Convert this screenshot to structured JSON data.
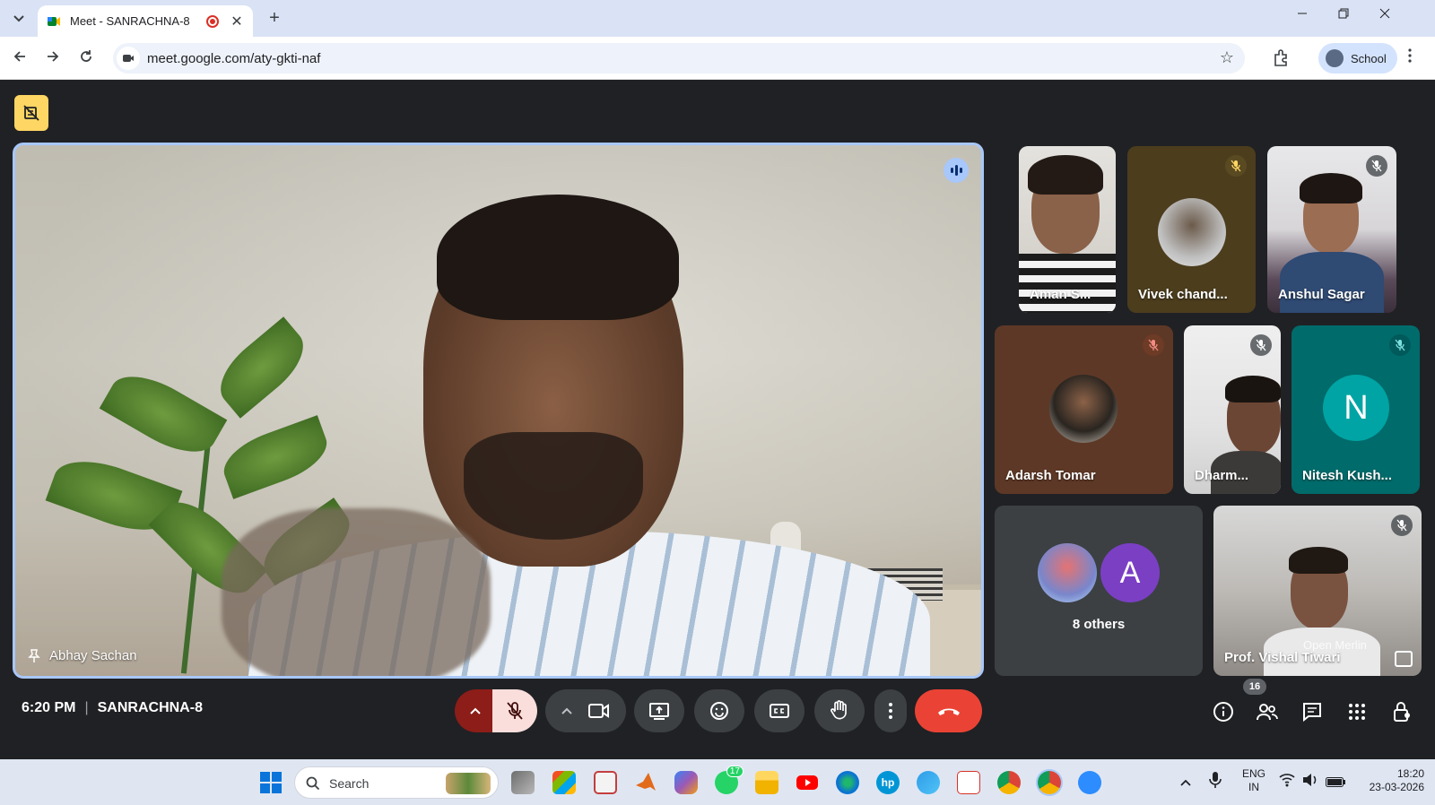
{
  "browser": {
    "tab_title": "Meet - SANRACHNA-8",
    "tab_close": "✕",
    "new_tab": "+",
    "url": "meet.google.com/aty-gkti-naf",
    "profile_label": "School"
  },
  "meet": {
    "main_speaker": "Abhay Sachan",
    "participants": [
      {
        "name": "Aman S...",
        "muted": false
      },
      {
        "name": "Vivek chand...",
        "muted": true
      },
      {
        "name": "Anshul Sagar",
        "muted": true
      },
      {
        "name": "Adarsh Tomar",
        "muted": true
      },
      {
        "name": "Dharm...",
        "muted": true
      },
      {
        "name": "Nitesh Kush...",
        "muted": true,
        "initial": "N"
      },
      {
        "name": "Prof. Vishal Tiwari",
        "muted": true
      }
    ],
    "others": {
      "label": "8 others",
      "avatar_initial": "A"
    },
    "overlay_text": "Open Merlin",
    "time": "6:20 PM",
    "meeting_name": "SANRACHNA-8",
    "participant_count": "16"
  },
  "taskbar": {
    "search_placeholder": "Search",
    "whatsapp_badge": "17",
    "lang_top": "ENG",
    "lang_bottom": "IN",
    "clock_time": "18:20",
    "clock_date": "23-03-2026"
  },
  "colors": {
    "accent": "#a8c7fa",
    "leave_red": "#ea4335",
    "meet_bg": "#202124"
  }
}
